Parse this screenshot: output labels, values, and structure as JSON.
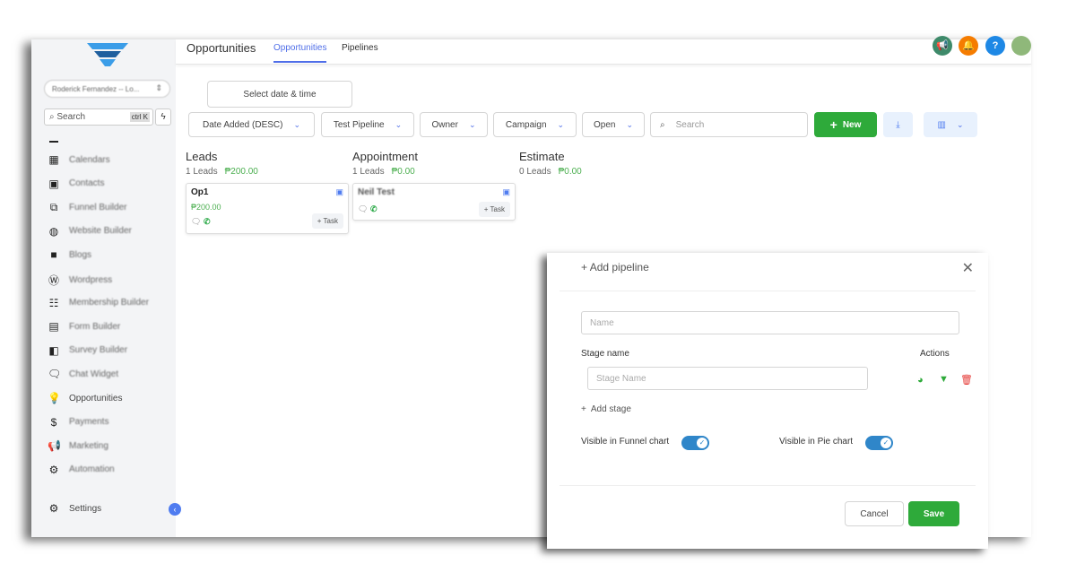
{
  "sidebar": {
    "account": "Roderick Fernandez -- Lo...",
    "search_placeholder": "Search",
    "search_shortcut": "ctrl K",
    "items": [
      {
        "label": "Calendars",
        "icon": "calendar-icon"
      },
      {
        "label": "Contacts",
        "icon": "contacts-icon"
      },
      {
        "label": "Funnel Builder",
        "icon": "funnel-builder-icon"
      },
      {
        "label": "Website Builder",
        "icon": "globe-icon"
      },
      {
        "label": "Blogs",
        "icon": "blog-icon"
      },
      {
        "label": "Wordpress",
        "icon": "wordpress-icon"
      },
      {
        "label": "Membership Builder",
        "icon": "members-icon"
      },
      {
        "label": "Form Builder",
        "icon": "form-icon"
      },
      {
        "label": "Survey Builder",
        "icon": "survey-icon"
      },
      {
        "label": "Chat Widget",
        "icon": "chat-icon"
      },
      {
        "label": "Opportunities",
        "icon": "lightbulb-icon"
      },
      {
        "label": "Payments",
        "icon": "payments-icon"
      },
      {
        "label": "Marketing",
        "icon": "megaphone-icon"
      },
      {
        "label": "Automation",
        "icon": "automation-icon"
      }
    ],
    "settings": "Settings"
  },
  "header": {
    "title": "Opportunities",
    "tabs": [
      "Opportunities",
      "Pipelines"
    ],
    "active_tab": "Opportunities"
  },
  "toolbar": {
    "date_button": "Select date & time",
    "sort": "Date Added (DESC)",
    "pipeline": "Test Pipeline",
    "owner": "Owner",
    "campaign": "Campaign",
    "status": "Open",
    "search_placeholder": "Search",
    "new_button": "New"
  },
  "columns": [
    {
      "title": "Leads",
      "count": "1 Leads",
      "amount": "₱200.00",
      "cards": [
        {
          "name": "Op1",
          "amount": "₱200.00",
          "task": "+ Task"
        }
      ]
    },
    {
      "title": "Appointment",
      "count": "1 Leads",
      "amount": "₱0.00",
      "cards": [
        {
          "name": "Neil Test",
          "task": "+ Task"
        }
      ]
    },
    {
      "title": "Estimate",
      "count": "0 Leads",
      "amount": "₱0.00",
      "cards": []
    }
  ],
  "modal": {
    "title": "Add pipeline",
    "name_placeholder": "Name",
    "stage_header": "Stage name",
    "actions_header": "Actions",
    "stage_placeholder": "Stage Name",
    "add_stage": "Add stage",
    "funnel_toggle": "Visible in Funnel chart",
    "pie_toggle": "Visible in Pie chart",
    "funnel_on": true,
    "pie_on": true,
    "cancel": "Cancel",
    "save": "Save"
  },
  "colors": {
    "accent": "#4f6ee8",
    "green": "#2eaa3a",
    "danger": "#e53935"
  }
}
